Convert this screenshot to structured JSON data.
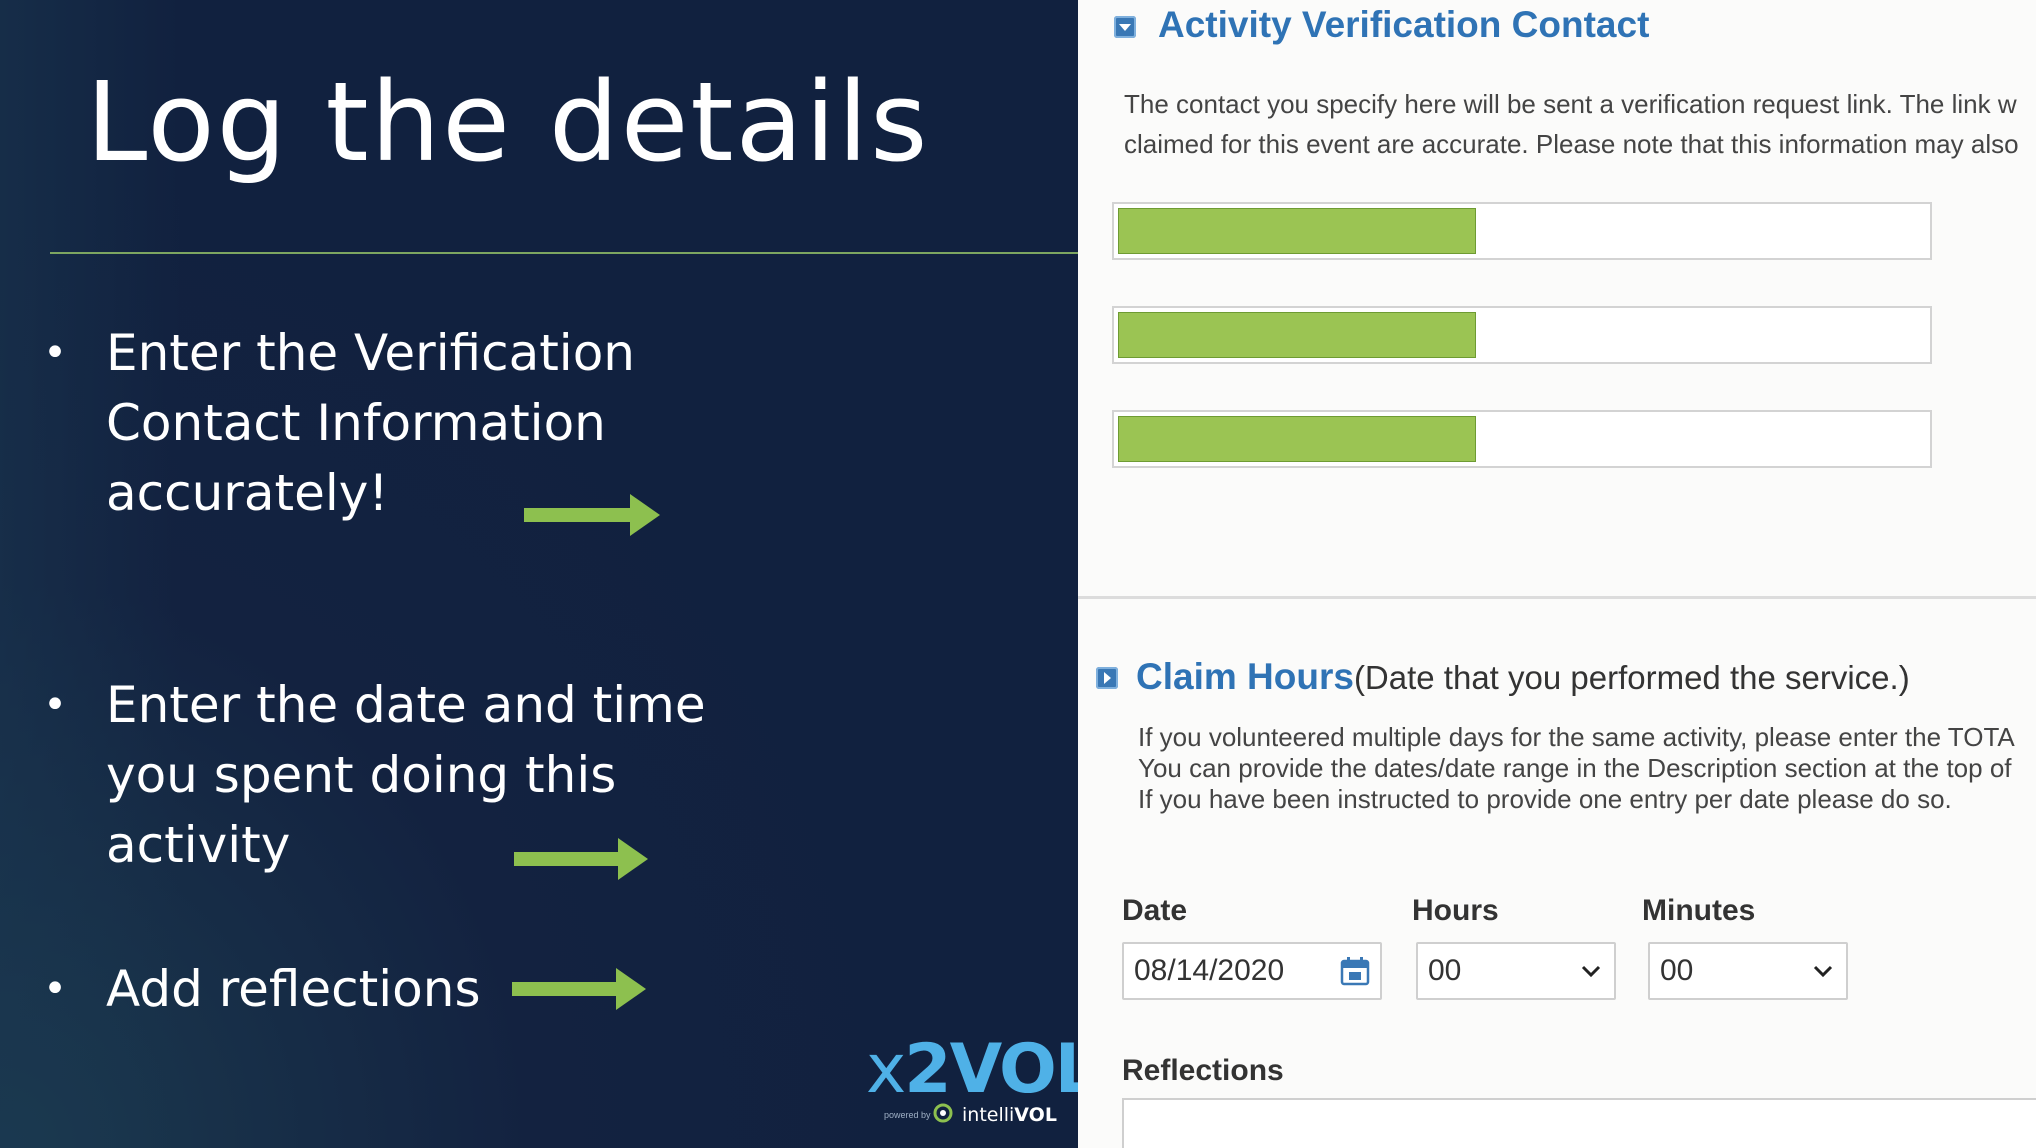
{
  "slide": {
    "title": "Log the details",
    "bullets": [
      {
        "lines": [
          "Enter the Verification",
          "Contact Information",
          "accurately!"
        ]
      },
      {
        "lines": [
          "Enter the date and time",
          "you spent doing this",
          "activity"
        ]
      },
      {
        "lines": [
          "Add reflections"
        ]
      }
    ],
    "bullet_char": "•",
    "arrow_color": "#8dc04f",
    "logo": {
      "x": "x",
      "brand": "2VOL",
      "powered_by": "powered by",
      "intelli": "intelli",
      "vol": "VOL"
    }
  },
  "form": {
    "verification": {
      "title": "Activity Verification Contact",
      "description_lines": [
        "The contact you specify here will be sent a verification request link. The link w",
        "claimed for this event are accurate. Please note that this information may also"
      ],
      "fields_redacted_color": "#9bc453"
    },
    "claim_hours": {
      "title": "Claim Hours",
      "subtitle": "(Date that you performed the service.)",
      "description_lines": [
        "If you volunteered multiple days for the same activity, please enter the TOTA",
        "You can provide the dates/date range in the Description section at the top of",
        "If you have been instructed to provide one entry per date please do so."
      ],
      "date": {
        "label": "Date",
        "value": "08/14/2020",
        "icon": "calendar-icon"
      },
      "hours": {
        "label": "Hours",
        "value": "00"
      },
      "minutes": {
        "label": "Minutes",
        "value": "00"
      },
      "reflections": {
        "label": "Reflections",
        "value": ""
      }
    }
  }
}
